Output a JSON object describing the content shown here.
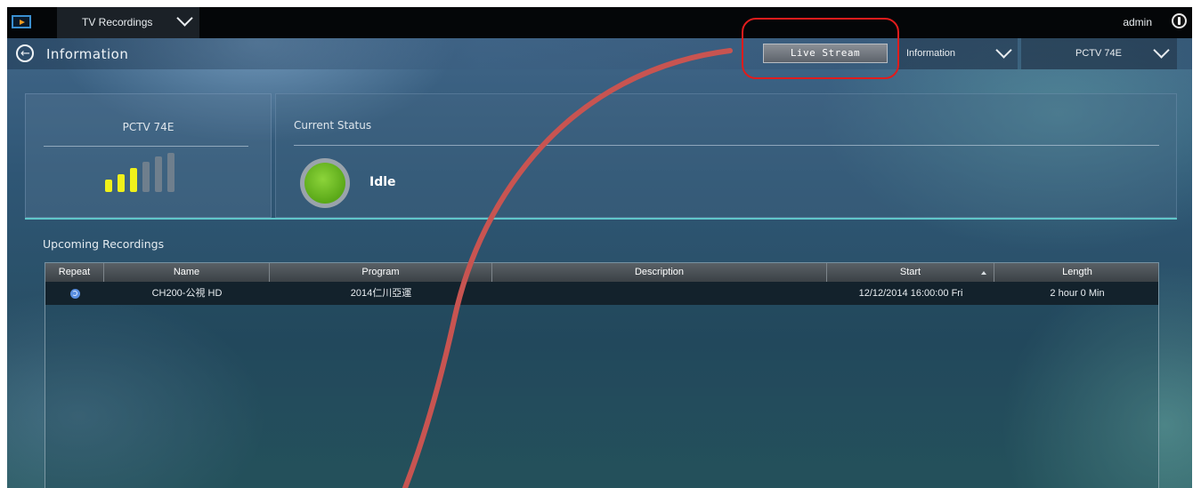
{
  "topbar": {
    "app_switch_label": "TV Recordings",
    "user_label": "admin"
  },
  "navbar": {
    "title": "Information",
    "live_stream_label": "Live Stream",
    "view_dropdown_label": "Information",
    "device_dropdown_label": "PCTV 74E"
  },
  "device_panel": {
    "name": "PCTV 74E",
    "signal_bars_filled": 3,
    "signal_bars_total": 6
  },
  "status_panel": {
    "label": "Current Status",
    "value": "Idle"
  },
  "upcoming": {
    "title": "Upcoming Recordings",
    "columns": [
      "Repeat",
      "Name",
      "Program",
      "Description",
      "Start",
      "Length"
    ],
    "rows": [
      {
        "repeat": "repeat-icon",
        "name": "CH200-公視 HD",
        "program": "2014仁川亞運",
        "description": "",
        "start": "12/12/2014  16:00:00  Fri",
        "length": "2 hour  0 Min"
      }
    ]
  },
  "colors": {
    "signal_on": "#f0f01a",
    "signal_off": "#6f7f8d",
    "status_idle": "#6bbd25",
    "annotation": "#c85451",
    "highlight": "#e01c1c",
    "accent_line": "#5fc6c9"
  }
}
